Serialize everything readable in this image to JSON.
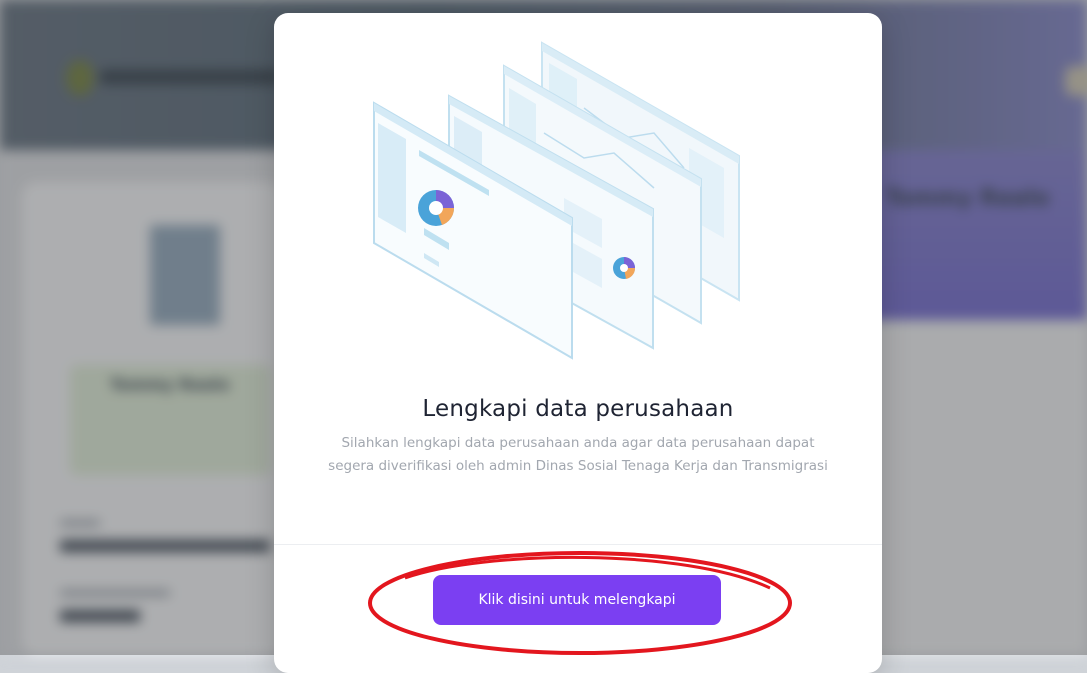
{
  "background": {
    "brand_text": "DINAS SOSIAL TENAGA KERJA",
    "right_heading": "Tommy Realo",
    "card_name": "Tommy Realo",
    "card_small": "Perusahaan",
    "card_value": "Baru"
  },
  "modal": {
    "title": "Lengkapi data perusahaan",
    "description": "Silahkan lengkapi data perusahaan anda agar data perusahaan dapat segera diverifikasi oleh admin Dinas Sosial Tenaga Kerja dan Transmigrasi",
    "cta_label": "Klik disini untuk melengkapi"
  },
  "colors": {
    "primary_button": "#7b3ff2",
    "annotation": "#e3161e",
    "title": "#1f2433",
    "description": "#a2a7af"
  }
}
